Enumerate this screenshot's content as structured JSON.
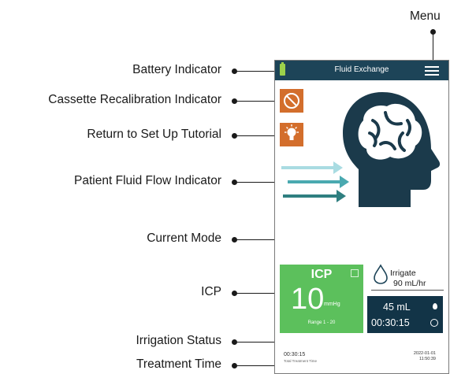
{
  "callouts": {
    "menu": "Menu",
    "battery": "Battery Indicator",
    "cassette": "Cassette Recalibration Indicator",
    "tutorial": "Return to Set Up Tutorial",
    "flow": "Patient Fluid Flow Indicator",
    "current_mode": "Current Mode",
    "icp": "ICP",
    "irrigation_status": "Irrigation Status",
    "treatment_time": "Treatment Time"
  },
  "device": {
    "header_title": "Fluid Exchange",
    "icp": {
      "label": "ICP",
      "value": "10",
      "unit": "mmHg",
      "range": "Range 1 - 20"
    },
    "mode": {
      "label": "Irrigate",
      "rate": "90 mL/hr"
    },
    "irrigation": {
      "volume": "45 mL",
      "elapsed": "00:30:15"
    },
    "footer": {
      "treatment_time": "00:30:15",
      "treatment_label": "Total Treatment Time",
      "date": "2022-01-01",
      "clock": "11:50:39"
    }
  },
  "colors": {
    "header": "#1d4458",
    "tile": "#d36e2c",
    "icp_card": "#5cc05c",
    "status_box": "#123447",
    "battery": "#9cd14b",
    "flow_light": "#a9dce2",
    "flow_mid": "#4aa9b0",
    "flow_dark": "#2f7f80",
    "head": "#1b3a4b"
  }
}
